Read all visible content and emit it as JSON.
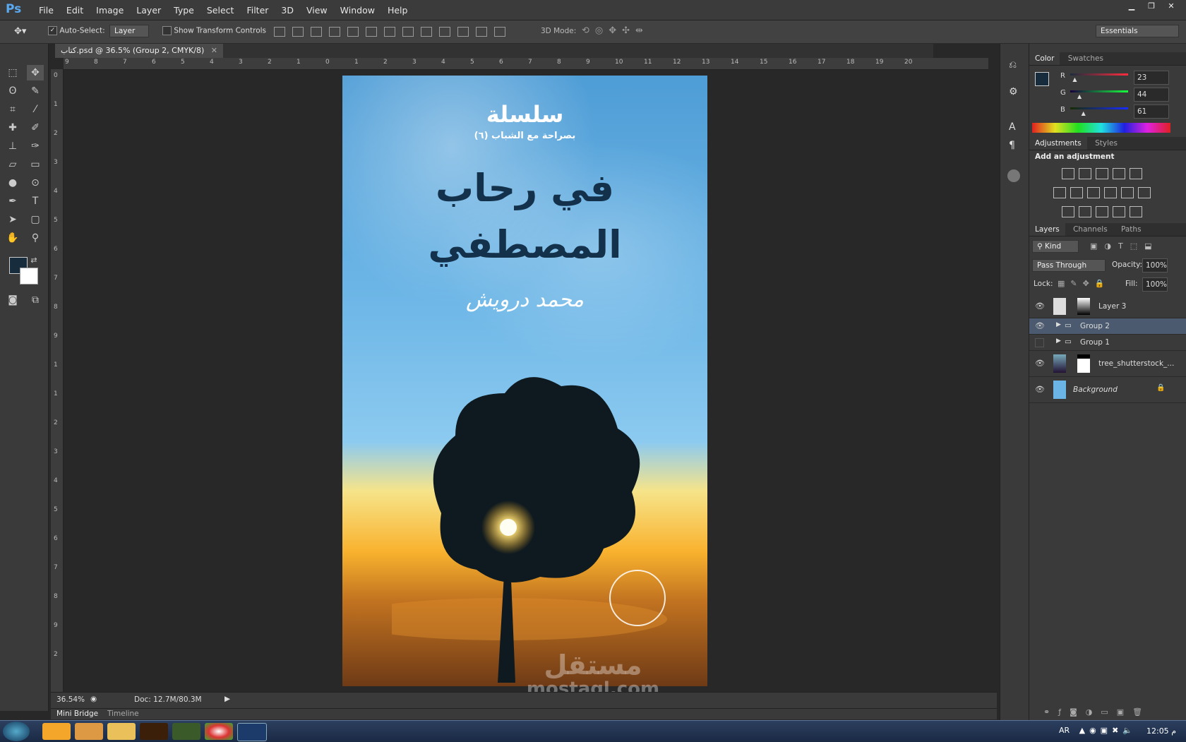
{
  "app": {
    "logo": "Ps"
  },
  "menu": [
    "File",
    "Edit",
    "Image",
    "Layer",
    "Type",
    "Select",
    "Filter",
    "3D",
    "View",
    "Window",
    "Help"
  ],
  "options": {
    "auto_select_label": "Auto-Select:",
    "auto_select_value": "Layer",
    "transform_label": "Show Transform Controls",
    "mode_label": "3D Mode:",
    "workspace": "Essentials"
  },
  "document": {
    "tab": "كتاب.psd @ 36.5% (Group 2, CMYK/8)"
  },
  "ruler": {
    "h": [
      "9",
      "8",
      "7",
      "6",
      "5",
      "4",
      "3",
      "2",
      "1",
      "0",
      "1",
      "2",
      "3",
      "4",
      "5",
      "6",
      "7",
      "8",
      "9",
      "10",
      "11",
      "12",
      "13",
      "14",
      "15",
      "16",
      "17",
      "18",
      "19",
      "20"
    ],
    "v": [
      "0",
      "1",
      "2",
      "3",
      "4",
      "5",
      "6",
      "7",
      "8",
      "9",
      "1",
      "1",
      "2",
      "3",
      "4",
      "5",
      "6",
      "7",
      "8",
      "9",
      "2"
    ]
  },
  "artwork": {
    "series": "سلسلة",
    "series_sub": "بصراحة مع الشباب (٦)",
    "title_line1": "في رحاب",
    "title_line2": "المصطفي",
    "author": "محمد درويش"
  },
  "status": {
    "zoom": "36.54%",
    "doc": "Doc: 12.7M/80.3M"
  },
  "bottom_tabs": [
    "Mini Bridge",
    "Timeline"
  ],
  "color_panel": {
    "tabs": [
      "Color",
      "Swatches"
    ],
    "r_label": "R",
    "g_label": "G",
    "b_label": "B",
    "r": "23",
    "g": "44",
    "b": "61",
    "r_level": 0.09,
    "g_level": 0.17,
    "b_level": 0.24,
    "foreground": "#172c3d",
    "background": "#ffffff"
  },
  "adjustments": {
    "tabs": [
      "Adjustments",
      "Styles"
    ],
    "heading": "Add an adjustment"
  },
  "layers_panel": {
    "tabs": [
      "Layers",
      "Channels",
      "Paths"
    ],
    "filter": "Kind",
    "blend": "Pass Through",
    "opacity_label": "Opacity:",
    "opacity": "100%",
    "lock_label": "Lock:",
    "fill_label": "Fill:",
    "fill": "100%",
    "layers": [
      {
        "name": "Layer 3"
      },
      {
        "name": "Group 2"
      },
      {
        "name": "Group 1"
      },
      {
        "name": "tree_shutterstock_..."
      },
      {
        "name": "Background"
      }
    ]
  },
  "taskbar": {
    "lang": "AR",
    "time": "12:05 م"
  },
  "watermark": {
    "line1": "مستقل",
    "line2": "mostaql.com"
  }
}
